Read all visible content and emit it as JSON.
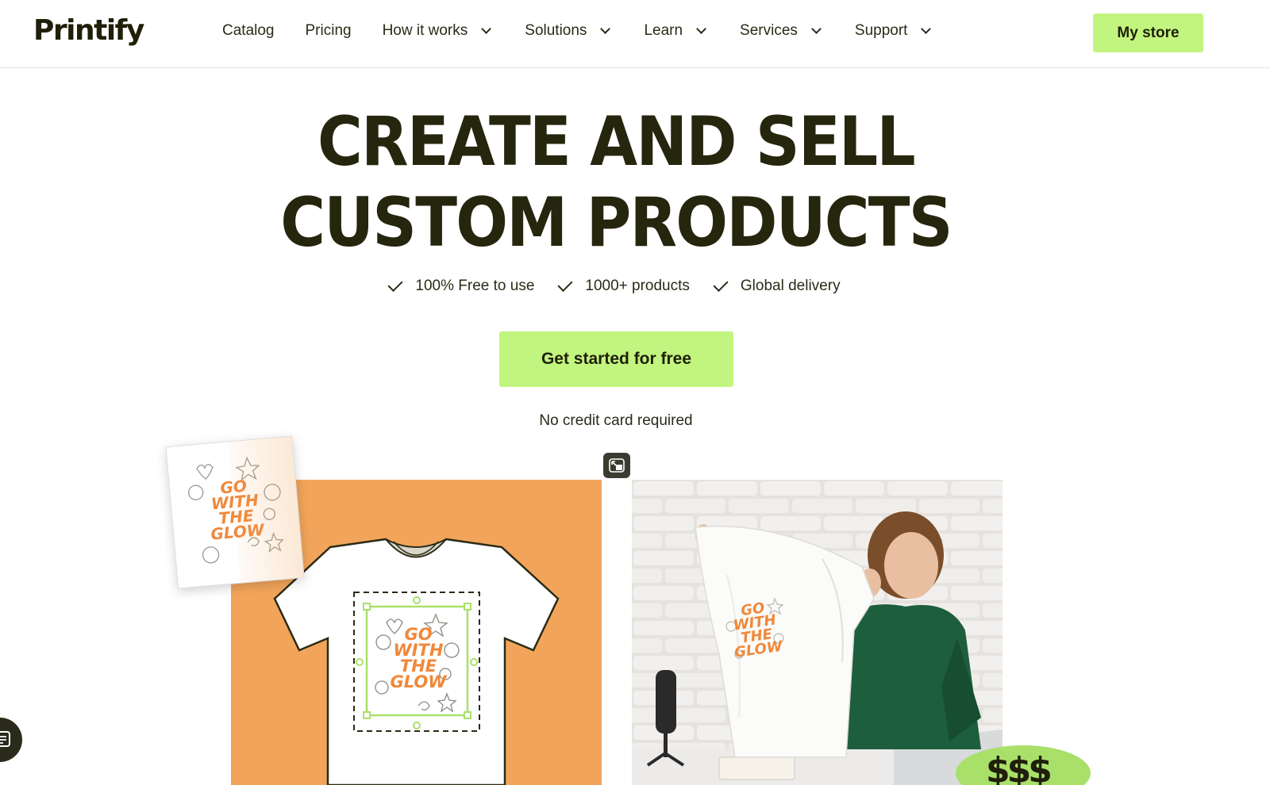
{
  "header": {
    "logo": "Printify",
    "nav": [
      {
        "label": "Catalog",
        "dropdown": false
      },
      {
        "label": "Pricing",
        "dropdown": false
      },
      {
        "label": "How it works",
        "dropdown": true
      },
      {
        "label": "Solutions",
        "dropdown": true
      },
      {
        "label": "Learn",
        "dropdown": true
      },
      {
        "label": "Services",
        "dropdown": true
      },
      {
        "label": "Support",
        "dropdown": true
      }
    ],
    "store_button": "My store"
  },
  "hero": {
    "title_line1": "CREATE AND SELL",
    "title_line2": "CUSTOM PRODUCTS",
    "features": [
      "100% Free to use",
      "1000+ products",
      "Global delivery"
    ],
    "cta": "Get started for free",
    "subtext": "No credit card required"
  },
  "design": {
    "lines": [
      "GO",
      "WITH",
      "THE",
      "GLOW"
    ]
  },
  "badge": "$$$",
  "colors": {
    "accent": "#c2f57f",
    "text_dark": "#26260e",
    "orange_panel": "#f2a55a",
    "design_orange": "#f0883a",
    "sweater_green": "#1d5e3c"
  },
  "icons": {
    "check": "check-icon",
    "chevron": "chevron-down-icon",
    "swap": "swap-view-icon",
    "chat": "chat-icon"
  }
}
